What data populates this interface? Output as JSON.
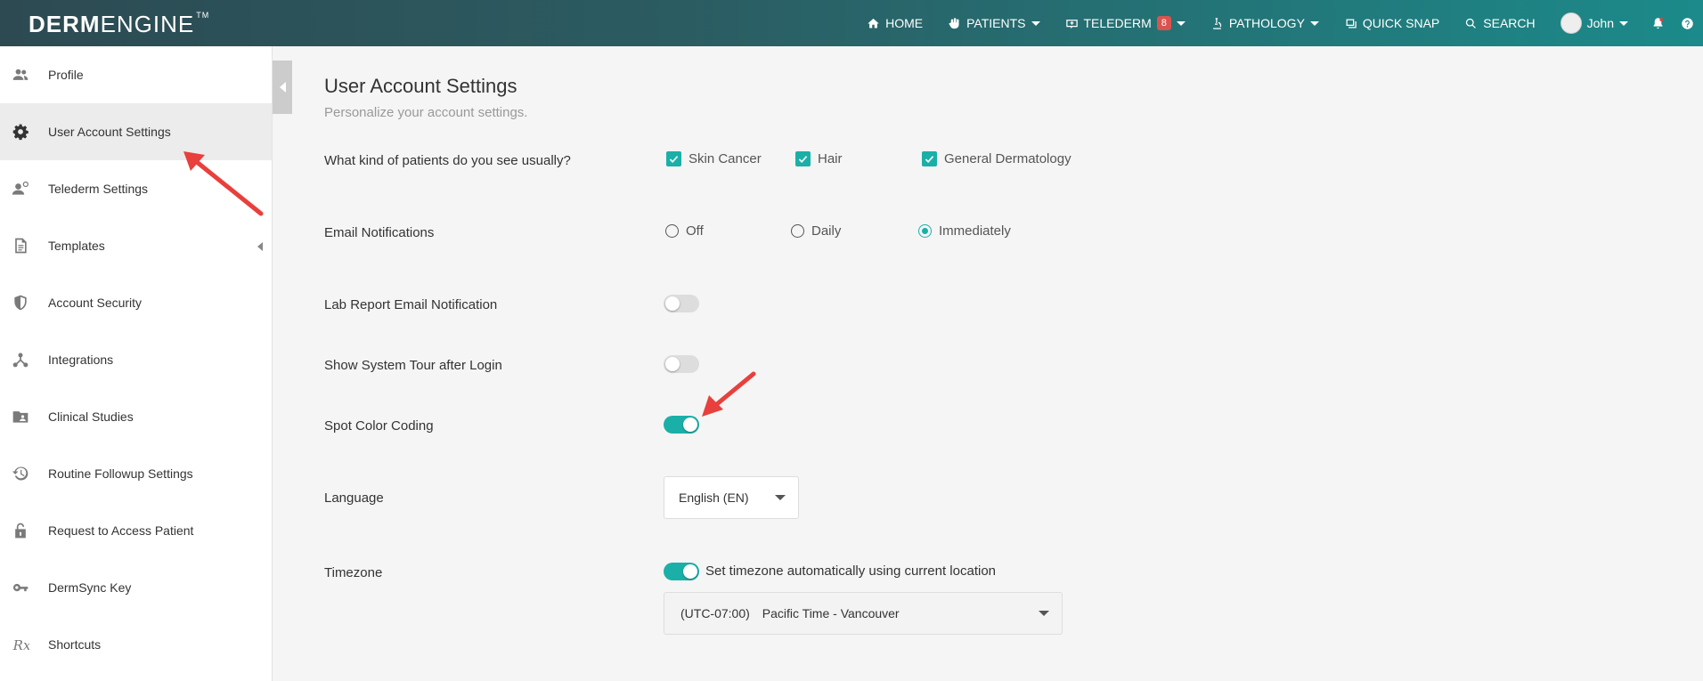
{
  "app": {
    "logo_bold": "DERM",
    "logo_light": "ENGINE",
    "logo_tm": "TM"
  },
  "nav": {
    "home": "HOME",
    "patients": "PATIENTS",
    "telederm": "TELEDERM",
    "telederm_badge": "8",
    "pathology": "PATHOLOGY",
    "quick_snap": "QUICK SNAP",
    "search": "SEARCH",
    "user": "John"
  },
  "sidebar": {
    "items": [
      {
        "label": "Profile",
        "icon": "people-icon"
      },
      {
        "label": "User Account Settings",
        "icon": "gear-icon",
        "active": true
      },
      {
        "label": "Telederm Settings",
        "icon": "user-settings-icon"
      },
      {
        "label": "Templates",
        "icon": "document-icon"
      },
      {
        "label": "Account Security",
        "icon": "shield-icon"
      },
      {
        "label": "Integrations",
        "icon": "network-icon"
      },
      {
        "label": "Clinical Studies",
        "icon": "folder-user-icon"
      },
      {
        "label": "Routine Followup Settings",
        "icon": "history-icon"
      },
      {
        "label": "Request to Access Patient",
        "icon": "lock-icon"
      },
      {
        "label": "DermSync Key",
        "icon": "key-icon"
      },
      {
        "label": "Shortcuts",
        "icon": "rx-icon"
      }
    ]
  },
  "main": {
    "title": "User Account Settings",
    "subtitle": "Personalize your account settings.",
    "patients_question": "What kind of patients do you see usually?",
    "patient_types": [
      "Skin Cancer",
      "Hair",
      "General Dermatology"
    ],
    "email_label": "Email Notifications",
    "email_options": [
      "Off",
      "Daily",
      "Immediately"
    ],
    "email_selected": "Immediately",
    "lab_report_label": "Lab Report Email Notification",
    "lab_report_on": false,
    "tour_label": "Show System Tour after Login",
    "tour_on": false,
    "spot_color_label": "Spot Color Coding",
    "spot_color_on": true,
    "language_label": "Language",
    "language_value": "English (EN)",
    "timezone_label": "Timezone",
    "timezone_auto_label": "Set timezone automatically using current location",
    "timezone_auto_on": true,
    "timezone_offset": "(UTC-07:00)",
    "timezone_name": "Pacific Time - Vancouver"
  },
  "colors": {
    "accent": "#1ab0a8",
    "annotation_arrow": "#e8403c"
  }
}
